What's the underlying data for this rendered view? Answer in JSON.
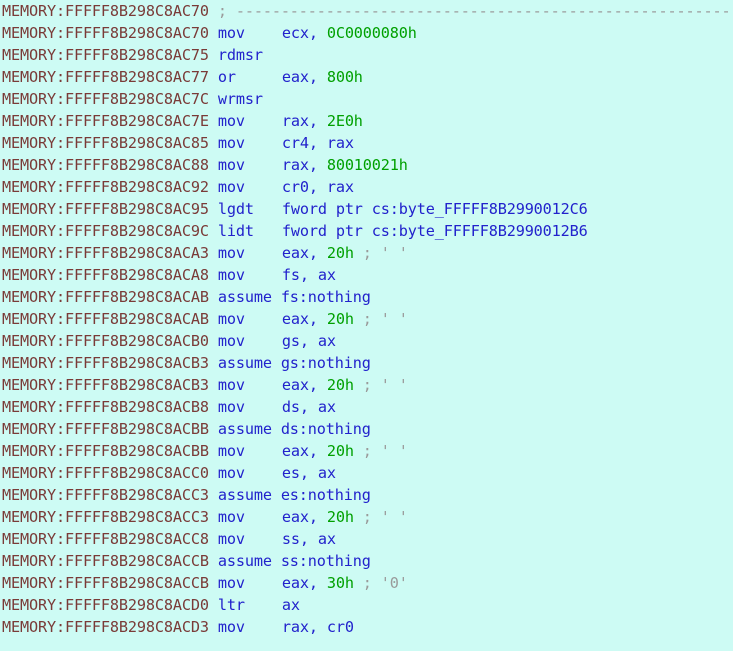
{
  "view": {
    "name": "IDA Pro disassembly listing",
    "segment": "MEMORY",
    "background_color": "#cdfbf4",
    "colors": {
      "address": "#7a3b38",
      "mnemonic": "#2222cc",
      "register": "#2222cc",
      "immediate": "#00a000",
      "comment": "#9a9a9a",
      "directive": "#2222cc"
    }
  },
  "lines": [
    {
      "address": "MEMORY:FFFFF8B298C8AC70",
      "kind": "comment",
      "mnemonic": "",
      "operands": "",
      "comment": "; ---------------------------------------------------------------------------"
    },
    {
      "address": "MEMORY:FFFFF8B298C8AC70",
      "kind": "instruction",
      "mnemonic": "mov",
      "operands": "ecx, 0C0000080h",
      "op_reg": "ecx, ",
      "op_imm": "0C0000080h",
      "comment": ""
    },
    {
      "address": "MEMORY:FFFFF8B298C8AC75",
      "kind": "instruction",
      "mnemonic": "rdmsr",
      "operands": "",
      "op_reg": "",
      "op_imm": "",
      "comment": ""
    },
    {
      "address": "MEMORY:FFFFF8B298C8AC77",
      "kind": "instruction",
      "mnemonic": "or",
      "operands": "eax, 800h",
      "op_reg": "eax, ",
      "op_imm": "800h",
      "comment": ""
    },
    {
      "address": "MEMORY:FFFFF8B298C8AC7C",
      "kind": "instruction",
      "mnemonic": "wrmsr",
      "operands": "",
      "op_reg": "",
      "op_imm": "",
      "comment": ""
    },
    {
      "address": "MEMORY:FFFFF8B298C8AC7E",
      "kind": "instruction",
      "mnemonic": "mov",
      "operands": "rax, 2E0h",
      "op_reg": "rax, ",
      "op_imm": "2E0h",
      "comment": ""
    },
    {
      "address": "MEMORY:FFFFF8B298C8AC85",
      "kind": "instruction",
      "mnemonic": "mov",
      "operands": "cr4, rax",
      "op_reg": "cr4, rax",
      "op_imm": "",
      "comment": ""
    },
    {
      "address": "MEMORY:FFFFF8B298C8AC88",
      "kind": "instruction",
      "mnemonic": "mov",
      "operands": "rax, 80010021h",
      "op_reg": "rax, ",
      "op_imm": "80010021h",
      "comment": ""
    },
    {
      "address": "MEMORY:FFFFF8B298C8AC92",
      "kind": "instruction",
      "mnemonic": "mov",
      "operands": "cr0, rax",
      "op_reg": "cr0, rax",
      "op_imm": "",
      "comment": ""
    },
    {
      "address": "MEMORY:FFFFF8B298C8AC95",
      "kind": "instruction",
      "mnemonic": "lgdt",
      "operands": "fword ptr cs:byte_FFFFF8B2990012C6",
      "op_reg": "fword ptr cs:byte_FFFFF8B2990012C6",
      "op_imm": "",
      "comment": ""
    },
    {
      "address": "MEMORY:FFFFF8B298C8AC9C",
      "kind": "instruction",
      "mnemonic": "lidt",
      "operands": "fword ptr cs:byte_FFFFF8B2990012B6",
      "op_reg": "fword ptr cs:byte_FFFFF8B2990012B6",
      "op_imm": "",
      "comment": ""
    },
    {
      "address": "MEMORY:FFFFF8B298C8ACA3",
      "kind": "instruction",
      "mnemonic": "mov",
      "operands": "eax, 20h",
      "op_reg": "eax, ",
      "op_imm": "20h",
      "comment": " ; ' '"
    },
    {
      "address": "MEMORY:FFFFF8B298C8ACA8",
      "kind": "instruction",
      "mnemonic": "mov",
      "operands": "fs, ax",
      "op_reg": "fs, ax",
      "op_imm": "",
      "comment": ""
    },
    {
      "address": "MEMORY:FFFFF8B298C8ACAB",
      "kind": "directive",
      "mnemonic": "assume",
      "operands": "fs:nothing",
      "directive_text": "assume fs:nothing",
      "comment": ""
    },
    {
      "address": "MEMORY:FFFFF8B298C8ACAB",
      "kind": "instruction",
      "mnemonic": "mov",
      "operands": "eax, 20h",
      "op_reg": "eax, ",
      "op_imm": "20h",
      "comment": " ; ' '"
    },
    {
      "address": "MEMORY:FFFFF8B298C8ACB0",
      "kind": "instruction",
      "mnemonic": "mov",
      "operands": "gs, ax",
      "op_reg": "gs, ax",
      "op_imm": "",
      "comment": ""
    },
    {
      "address": "MEMORY:FFFFF8B298C8ACB3",
      "kind": "directive",
      "mnemonic": "assume",
      "operands": "gs:nothing",
      "directive_text": "assume gs:nothing",
      "comment": ""
    },
    {
      "address": "MEMORY:FFFFF8B298C8ACB3",
      "kind": "instruction",
      "mnemonic": "mov",
      "operands": "eax, 20h",
      "op_reg": "eax, ",
      "op_imm": "20h",
      "comment": " ; ' '"
    },
    {
      "address": "MEMORY:FFFFF8B298C8ACB8",
      "kind": "instruction",
      "mnemonic": "mov",
      "operands": "ds, ax",
      "op_reg": "ds, ax",
      "op_imm": "",
      "comment": ""
    },
    {
      "address": "MEMORY:FFFFF8B298C8ACBB",
      "kind": "directive",
      "mnemonic": "assume",
      "operands": "ds:nothing",
      "directive_text": "assume ds:nothing",
      "comment": ""
    },
    {
      "address": "MEMORY:FFFFF8B298C8ACBB",
      "kind": "instruction",
      "mnemonic": "mov",
      "operands": "eax, 20h",
      "op_reg": "eax, ",
      "op_imm": "20h",
      "comment": " ; ' '"
    },
    {
      "address": "MEMORY:FFFFF8B298C8ACC0",
      "kind": "instruction",
      "mnemonic": "mov",
      "operands": "es, ax",
      "op_reg": "es, ax",
      "op_imm": "",
      "comment": ""
    },
    {
      "address": "MEMORY:FFFFF8B298C8ACC3",
      "kind": "directive",
      "mnemonic": "assume",
      "operands": "es:nothing",
      "directive_text": "assume es:nothing",
      "comment": ""
    },
    {
      "address": "MEMORY:FFFFF8B298C8ACC3",
      "kind": "instruction",
      "mnemonic": "mov",
      "operands": "eax, 20h",
      "op_reg": "eax, ",
      "op_imm": "20h",
      "comment": " ; ' '"
    },
    {
      "address": "MEMORY:FFFFF8B298C8ACC8",
      "kind": "instruction",
      "mnemonic": "mov",
      "operands": "ss, ax",
      "op_reg": "ss, ax",
      "op_imm": "",
      "comment": ""
    },
    {
      "address": "MEMORY:FFFFF8B298C8ACCB",
      "kind": "directive",
      "mnemonic": "assume",
      "operands": "ss:nothing",
      "directive_text": "assume ss:nothing",
      "comment": ""
    },
    {
      "address": "MEMORY:FFFFF8B298C8ACCB",
      "kind": "instruction",
      "mnemonic": "mov",
      "operands": "eax, 30h",
      "op_reg": "eax, ",
      "op_imm": "30h",
      "comment": " ; '0'"
    },
    {
      "address": "MEMORY:FFFFF8B298C8ACD0",
      "kind": "instruction",
      "mnemonic": "ltr",
      "operands": "ax",
      "op_reg": "ax",
      "op_imm": "",
      "comment": ""
    },
    {
      "address": "MEMORY:FFFFF8B298C8ACD3",
      "kind": "instruction",
      "mnemonic": "mov",
      "operands": "rax, cr0",
      "op_reg": "rax, cr0",
      "op_imm": "",
      "comment": ""
    }
  ]
}
